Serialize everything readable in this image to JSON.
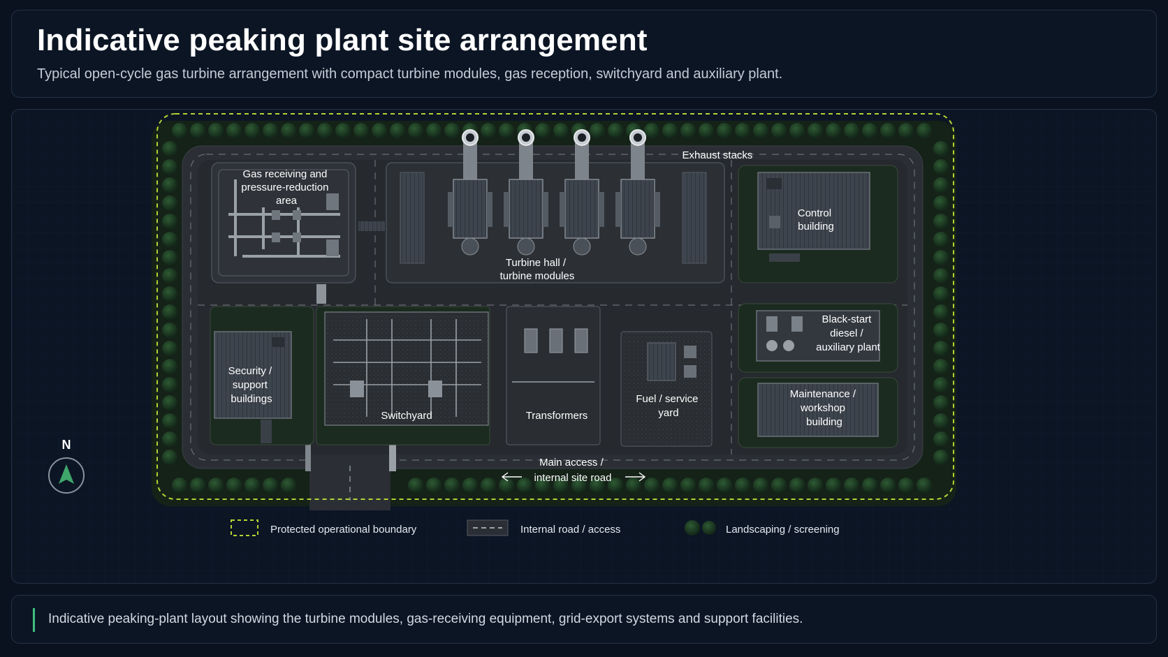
{
  "header": {
    "title": "Indicative peaking plant site arrangement",
    "subtitle": "Typical open-cycle gas turbine arrangement with compact turbine modules, gas reception, switchyard and auxiliary plant."
  },
  "diagram": {
    "labels": {
      "exhaust_stacks": "Exhaust stacks",
      "gas_receiving": [
        "Gas receiving and",
        "pressure-reduction",
        "area"
      ],
      "turbine_hall": [
        "Turbine hall /",
        "turbine modules"
      ],
      "control_building": [
        "Control",
        "building"
      ],
      "black_start": [
        "Black-start",
        "diesel /",
        "auxiliary plant"
      ],
      "maintenance": [
        "Maintenance /",
        "workshop",
        "building"
      ],
      "security": [
        "Security /",
        "support",
        "buildings"
      ],
      "switchyard": "Switchyard",
      "transformers": "Transformers",
      "fuel_yard": [
        "Fuel / service",
        "yard"
      ],
      "main_access": [
        "Main access /",
        "internal site road"
      ]
    },
    "north_label": "N",
    "legend": {
      "boundary": "Protected operational boundary",
      "road": "Internal road / access",
      "landscaping": "Landscaping / screening"
    },
    "colors": {
      "boundary": "#b5d334",
      "trees": "#1d3a22",
      "road": "#2b2f35",
      "roof": "#3b424b",
      "north_arrow": "#3fa66a",
      "caption_accent": "#3fbf7f"
    }
  },
  "caption": {
    "text": "Indicative peaking-plant layout showing the turbine modules, gas-receiving equipment, grid-export systems and support facilities."
  }
}
